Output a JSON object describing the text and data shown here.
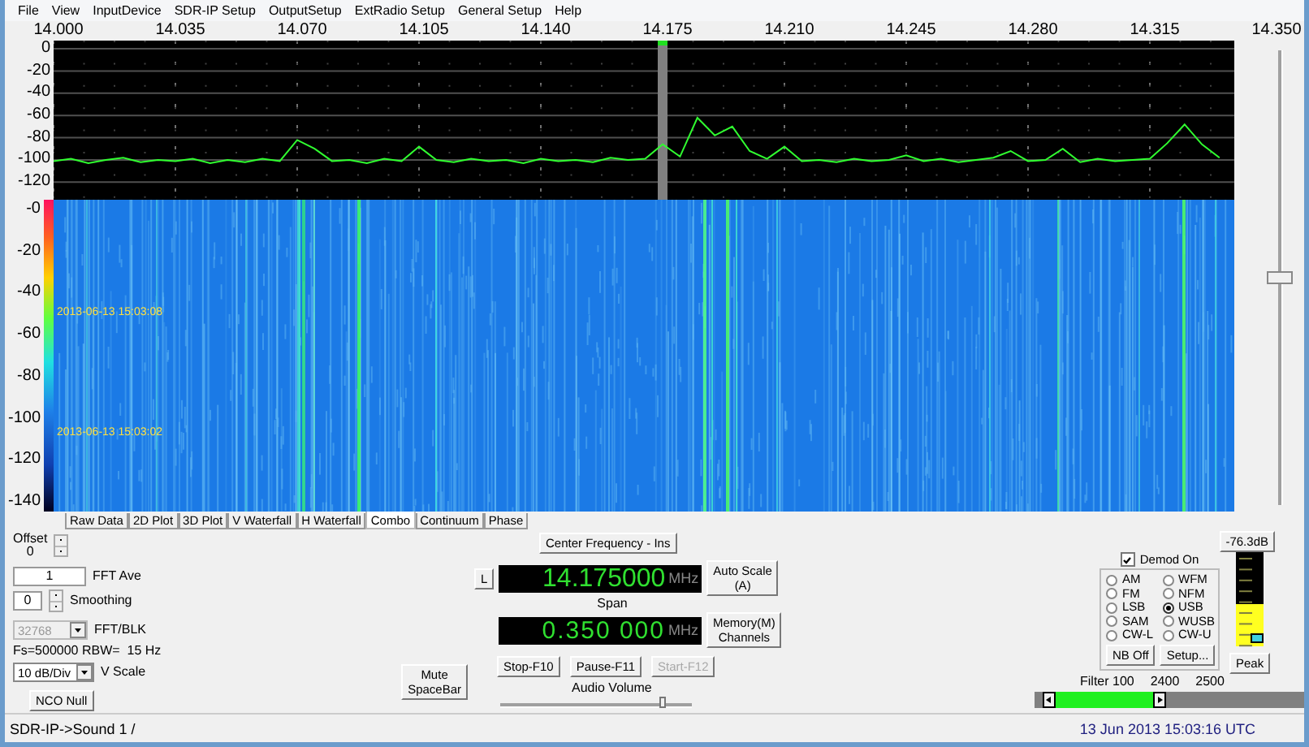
{
  "menu": [
    "File",
    "View",
    "InputDevice",
    "SDR-IP Setup",
    "OutputSetup",
    "ExtRadio Setup",
    "General Setup",
    "Help"
  ],
  "spectrum": {
    "chart_data": {
      "type": "line",
      "xlim": [
        14.0,
        14.35
      ],
      "ylim": [
        -135.8,
        7.3
      ],
      "grid": true,
      "xticks": [
        {
          "value": 14.0,
          "label": "14.000"
        },
        {
          "value": 14.035,
          "label": "14.035"
        },
        {
          "value": 14.07,
          "label": "14.070"
        },
        {
          "value": 14.105,
          "label": "14.105"
        },
        {
          "value": 14.14,
          "label": "14.140"
        },
        {
          "value": 14.175,
          "label": "14.175"
        },
        {
          "value": 14.21,
          "label": "14.210"
        },
        {
          "value": 14.245,
          "label": "14.245"
        },
        {
          "value": 14.28,
          "label": "14.280"
        },
        {
          "value": 14.315,
          "label": "14.315"
        },
        {
          "value": 14.35,
          "label": "14.350"
        }
      ],
      "yticks": [
        {
          "value": 0,
          "label": "0"
        },
        {
          "value": -20,
          "label": "-20"
        },
        {
          "value": -40,
          "label": "-40"
        },
        {
          "value": -60,
          "label": "-60"
        },
        {
          "value": -80,
          "label": "-80"
        },
        {
          "value": -100,
          "label": "-100"
        },
        {
          "value": -120,
          "label": "-120"
        }
      ],
      "x": [
        14.0,
        14.005,
        14.01,
        14.015,
        14.02,
        14.025,
        14.03,
        14.035,
        14.04,
        14.045,
        14.05,
        14.055,
        14.06,
        14.065,
        14.07,
        14.075,
        14.08,
        14.085,
        14.09,
        14.095,
        14.1,
        14.105,
        14.11,
        14.115,
        14.12,
        14.125,
        14.13,
        14.135,
        14.14,
        14.145,
        14.15,
        14.155,
        14.16,
        14.165,
        14.17,
        14.175,
        14.18,
        14.185,
        14.19,
        14.195,
        14.2,
        14.205,
        14.21,
        14.215,
        14.22,
        14.225,
        14.23,
        14.235,
        14.24,
        14.245,
        14.25,
        14.255,
        14.26,
        14.265,
        14.27,
        14.275,
        14.28,
        14.285,
        14.29,
        14.295,
        14.3,
        14.305,
        14.31,
        14.315,
        14.32,
        14.325,
        14.33,
        14.335
      ],
      "series": [
        {
          "color": "#30ff30",
          "values": [
            -101,
            -99,
            -103,
            -100,
            -98,
            -102,
            -100,
            -101,
            -99,
            -103,
            -100,
            -102,
            -99,
            -101,
            -82,
            -90,
            -101,
            -100,
            -103,
            -99,
            -101,
            -88,
            -100,
            -102,
            -99,
            -101,
            -100,
            -103,
            -99,
            -101,
            -100,
            -102,
            -98,
            -100,
            -99,
            -86,
            -97,
            -62,
            -78,
            -70,
            -92,
            -99,
            -88,
            -101,
            -100,
            -102,
            -99,
            -101,
            -100,
            -96,
            -101,
            -99,
            -102,
            -100,
            -98,
            -92,
            -101,
            -100,
            -90,
            -102,
            -99,
            -101,
            -100,
            -99,
            -85,
            -68,
            -86,
            -98
          ]
        }
      ]
    }
  },
  "waterfall": {
    "db_labels": [
      "-0",
      "-20",
      "-40",
      "-60",
      "-80",
      "-100",
      "-120",
      "-140"
    ],
    "timestamps": [
      "2013-06-13 15:03:08",
      "2013-06-13 15:03:02"
    ]
  },
  "side_slider": {
    "level": 0.5
  },
  "tabs": [
    {
      "label": "Raw Data",
      "selected": false
    },
    {
      "label": "2D Plot",
      "selected": false
    },
    {
      "label": "3D Plot",
      "selected": false
    },
    {
      "label": "V Waterfall",
      "selected": false
    },
    {
      "label": "H Waterfall",
      "selected": false
    },
    {
      "label": "Combo",
      "selected": true
    },
    {
      "label": "Continuum",
      "selected": false
    },
    {
      "label": "Phase",
      "selected": false
    }
  ],
  "left_controls": {
    "offset_label": "Offset",
    "offset_value": "0",
    "fft_ave_value": "1",
    "fft_ave_label": "FFT Ave",
    "smoothing_value": "0",
    "smoothing_label": "Smoothing",
    "fft_blk_value": "32768",
    "fft_blk_disabled": true,
    "fft_blk_label": "FFT/BLK",
    "rate_info": "Fs=500000 RBW=  15 Hz",
    "vscale_value": "10 dB/Div",
    "vscale_label": "V Scale",
    "nco_button": "NCO Null"
  },
  "tuning": {
    "center_button": "Center Frequency - Ins",
    "l_button": "L",
    "frequency": "14.175000",
    "frequency_unit": "MHz",
    "auto_scale_button": "Auto Scale\n(A)",
    "span_label": "Span",
    "span": "0.350 000",
    "span_unit": "MHz",
    "memory_button": "Memory(M)\nChannels",
    "mute_button": "Mute\nSpaceBar",
    "transport": [
      {
        "label": "Stop-F10",
        "disabled": false
      },
      {
        "label": "Pause-F11",
        "disabled": false
      },
      {
        "label": "Start-F12",
        "disabled": true
      }
    ],
    "volume_label": "Audio Volume",
    "volume": {
      "level": 0.85
    }
  },
  "demod": {
    "level_reading": "-76.3dB",
    "demod_on": {
      "label": "Demod On",
      "checked": true
    },
    "modes": [
      {
        "label": "AM",
        "selected": false
      },
      {
        "label": "WFM",
        "selected": false
      },
      {
        "label": "FM",
        "selected": false
      },
      {
        "label": "NFM",
        "selected": false
      },
      {
        "label": "LSB",
        "selected": false
      },
      {
        "label": "USB",
        "selected": true
      },
      {
        "label": "SAM",
        "selected": false
      },
      {
        "label": "WUSB",
        "selected": false
      },
      {
        "label": "CW-L",
        "selected": false
      },
      {
        "label": "CW-U",
        "selected": false
      }
    ],
    "nb_button": "NB Off",
    "setup_button": "Setup...",
    "meter": {
      "level": 0.45
    },
    "peak_button": "Peak",
    "filter_labels": [
      "Filter 100",
      "2400",
      "2500"
    ],
    "filter_bar": {
      "level": 0.46
    }
  },
  "status_bar": {
    "left": "SDR-IP->Sound 1  /",
    "right": "13 Jun 2013  15:03:16 UTC"
  }
}
